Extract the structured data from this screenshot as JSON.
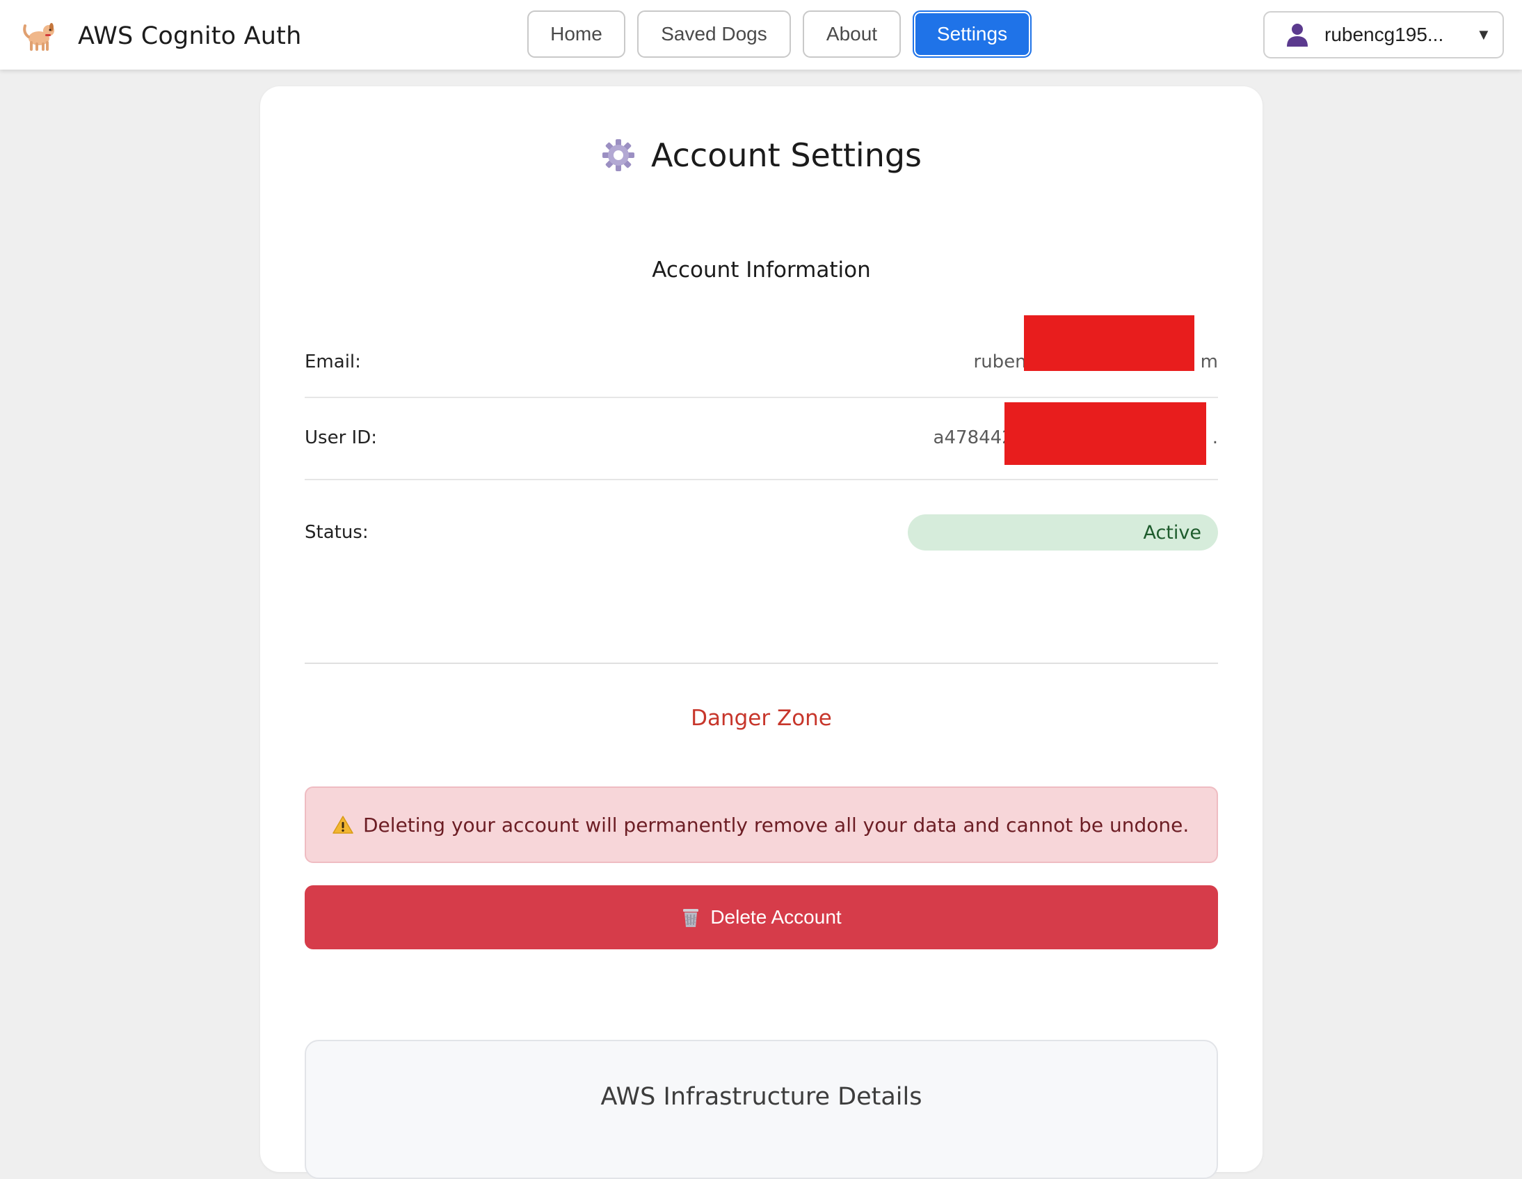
{
  "header": {
    "app_title": "AWS Cognito Auth",
    "logo_icon": "dog-icon",
    "nav": {
      "home": "Home",
      "saved_dogs": "Saved Dogs",
      "about": "About",
      "settings": "Settings",
      "active": "Settings"
    },
    "user_menu": {
      "username": "rubencg195...",
      "user_icon": "user-silhouette-icon",
      "chevron": "▼"
    }
  },
  "settings": {
    "title": "Account Settings",
    "title_icon": "gear-icon",
    "account_info": {
      "heading": "Account Information",
      "email_label": "Email:",
      "email_value_visible_start": "ruben",
      "email_value_visible_end": "m",
      "user_id_label": "User ID:",
      "user_id_value_visible_start": "a478442",
      "user_id_value_visible_end": ".",
      "status_label": "Status:",
      "status_value": "Active"
    },
    "danger_zone": {
      "heading": "Danger Zone",
      "warning_icon": "warning-icon",
      "warning_text": "Deleting your account will permanently remove all your data and cannot be undone.",
      "delete_icon": "wastebasket-icon",
      "delete_button": "Delete Account"
    },
    "infrastructure": {
      "title": "AWS Infrastructure Details"
    }
  },
  "colors": {
    "primary": "#1f73e8",
    "danger": "#d63c4a",
    "danger_text": "#c7362b",
    "warning_bg": "#f7d6d9",
    "status_bg": "#d6ecdb",
    "status_text": "#1d5b2c",
    "redaction": "#e81d1d"
  }
}
